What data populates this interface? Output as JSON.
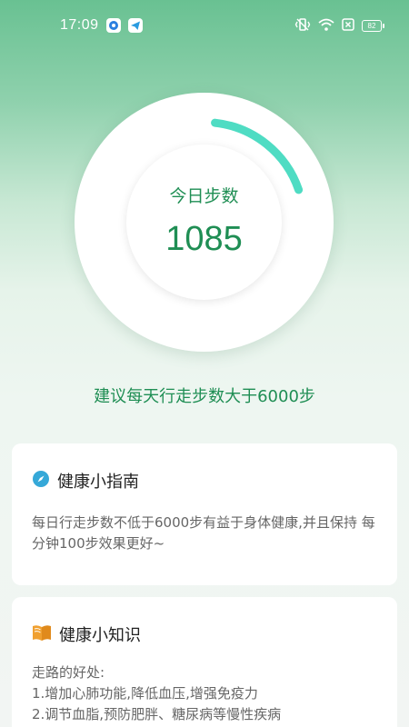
{
  "status_bar": {
    "time": "17:09",
    "battery": "82",
    "icons": [
      "mi-app-icon",
      "telegram-icon",
      "vibrate-icon",
      "wifi-icon",
      "sim-off-icon",
      "battery-icon"
    ]
  },
  "steps": {
    "label": "今日步数",
    "count": "1085",
    "progress": 0.18,
    "ring_color": "#4fdcc3"
  },
  "suggestion": "建议每天行走步数大于6000步",
  "guide_card": {
    "icon": "compass-icon",
    "title": "健康小指南",
    "body": "每日行走步数不低于6000步有益于身体健康,并且保持 每分钟100步效果更好~"
  },
  "knowledge_card": {
    "icon": "book-icon",
    "title": "健康小知识",
    "lines": [
      "走路的好处:",
      "1.增加心肺功能,降低血压,增强免疫力",
      "2.调节血脂,预防肥胖、糖尿病等慢性疾病"
    ]
  },
  "colors": {
    "accent_green": "#1f8e54",
    "header_green": "#69c192"
  }
}
